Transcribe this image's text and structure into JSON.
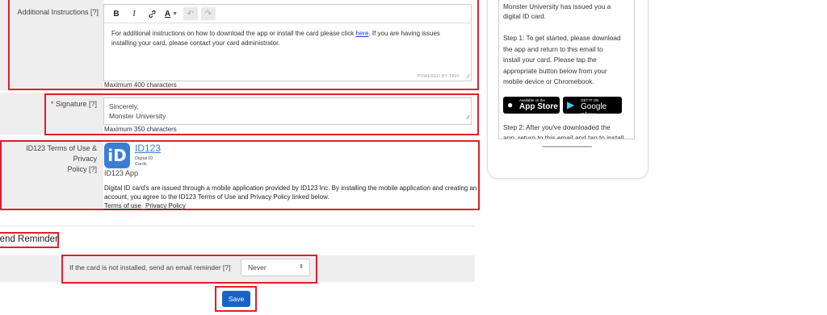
{
  "instructions": {
    "label": "Additional Instructions [?]",
    "toolbar": {
      "bold": "B",
      "italic": "I",
      "link_icon": "link-icon",
      "font_color": "A",
      "undo_icon": "undo-icon",
      "redo_icon": "redo-icon"
    },
    "text_before": "For additional instructions on how to download the app or install the card please click ",
    "link_text": "here",
    "text_after": ". If you are having issues installing your card, please contact your card administrator.",
    "powered": "POWERED BY TINY",
    "max": "Maximum 400 characters"
  },
  "signature": {
    "required_mark": "*",
    "label": "Signature [?]",
    "line1": "Sincerely,",
    "line2": "Monster University",
    "max": "Maximum 350 characters"
  },
  "terms": {
    "label_line1": "ID123 Terms of Use & Privacy",
    "label_line2": "Policy [?]",
    "brand": "ID123",
    "logo_letters": "iD",
    "logo_sub1": "Digital ID",
    "logo_sub2": "Cards",
    "app_name": "ID123 App",
    "body_line1": "Digital ID card's are issued through a mobile application provided by ID123 Inc. By installing the mobile application and creating an",
    "body_line2": "account, you agree to the ID123 Terms of Use and Privacy Policy linked below.",
    "terms_link": "Terms of use",
    "privacy_link": "Privacy Policy"
  },
  "reminder": {
    "heading": "Send Reminder",
    "label": "If the card is not installed, send an email reminder [?]",
    "selected": "Never"
  },
  "save_label": "Save",
  "phone": {
    "line1": "Monster University has issued you a",
    "line2": "digital ID card.",
    "step1_lines": [
      "Step 1: To get started, please download",
      "the app and return to this email to",
      "install your card. Please tap the",
      "appropriate button below from your",
      "mobile device or Chromebook."
    ],
    "appstore_small": "Available on the",
    "appstore_big": "App Store",
    "gplay_small": "GET IT ON",
    "gplay_big": "Google play",
    "step2_line1": "Step 2: After you've downloaded the",
    "step2_line2": "app, return to this email and tap to install"
  },
  "colors": {
    "accent": "#1a62c9",
    "highlight": "#e21d2c",
    "logo": "#3a7dd4"
  }
}
